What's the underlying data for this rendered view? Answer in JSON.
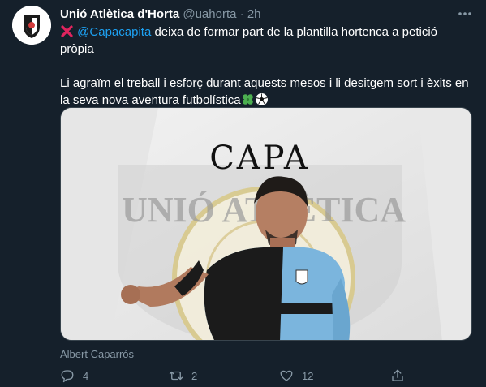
{
  "tweet": {
    "author_name": "Unió Atlètica d'Horta",
    "handle": "@uahorta",
    "separator": "·",
    "time": "2h",
    "mention": "@Capacapita",
    "line1_rest": " deixa de formar part de la plantilla hortenca a petició pròpia",
    "line2": "Li agraïm el treball i esforç durant aquests mesos i li desitgem sort i èxits en la seva nova aventura futbolística",
    "image_title": "CAPA",
    "image_badge_text": "UNIÓ ATLÈTICA",
    "media_credit": "Albert Caparrós",
    "counts": {
      "replies": "4",
      "retweets": "2",
      "likes": "12"
    }
  },
  "icons": {
    "avatar": "club-crest-icon",
    "more": "more-dots-icon",
    "cross": "red-cross-emoji",
    "clover": "four-leaf-clover-emoji",
    "ball": "soccer-ball-emoji",
    "reply": "reply-icon",
    "retweet": "retweet-icon",
    "like": "heart-icon",
    "share": "share-icon"
  },
  "colors": {
    "background": "#15202b",
    "link": "#1da1f2",
    "secondary": "#8899a6",
    "primary_text": "#ffffff"
  }
}
